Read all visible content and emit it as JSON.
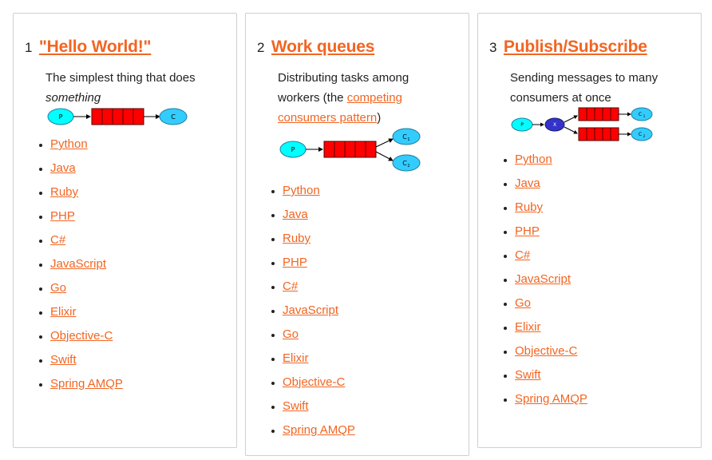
{
  "colors": {
    "accent": "#f26522",
    "queue": "#ff0000",
    "node": "#33ccff",
    "producer": "#00ffff",
    "exchange": "#3333cc"
  },
  "tutorials": [
    {
      "number": "1",
      "title": "\"Hello World!\"",
      "desc_text": "The simplest thing that does ",
      "desc_em": "something",
      "diagram": {
        "producer": "P",
        "consumer": "C"
      },
      "languages": [
        "Python",
        "Java",
        "Ruby",
        "PHP",
        "C#",
        "JavaScript",
        "Go",
        "Elixir",
        "Objective-C",
        "Swift",
        "Spring AMQP"
      ]
    },
    {
      "number": "2",
      "title": "Work queues",
      "desc_text": "Distributing tasks among workers (the ",
      "desc_link": "competing consumers pattern",
      "desc_after": ")",
      "diagram": {
        "producer": "P",
        "consumer1": "C",
        "consumer1_sub": "1",
        "consumer2": "C",
        "consumer2_sub": "2"
      },
      "languages": [
        "Python",
        "Java",
        "Ruby",
        "PHP",
        "C#",
        "JavaScript",
        "Go",
        "Elixir",
        "Objective-C",
        "Swift",
        "Spring AMQP"
      ]
    },
    {
      "number": "3",
      "title": "Publish/Subscribe",
      "desc_text": "Sending messages to many consumers at once",
      "diagram": {
        "producer": "P",
        "exchange": "X",
        "consumer1": "C",
        "consumer1_sub": "1",
        "consumer2": "C",
        "consumer2_sub": "2"
      },
      "languages": [
        "Python",
        "Java",
        "Ruby",
        "PHP",
        "C#",
        "JavaScript",
        "Go",
        "Elixir",
        "Objective-C",
        "Swift",
        "Spring AMQP"
      ]
    }
  ]
}
